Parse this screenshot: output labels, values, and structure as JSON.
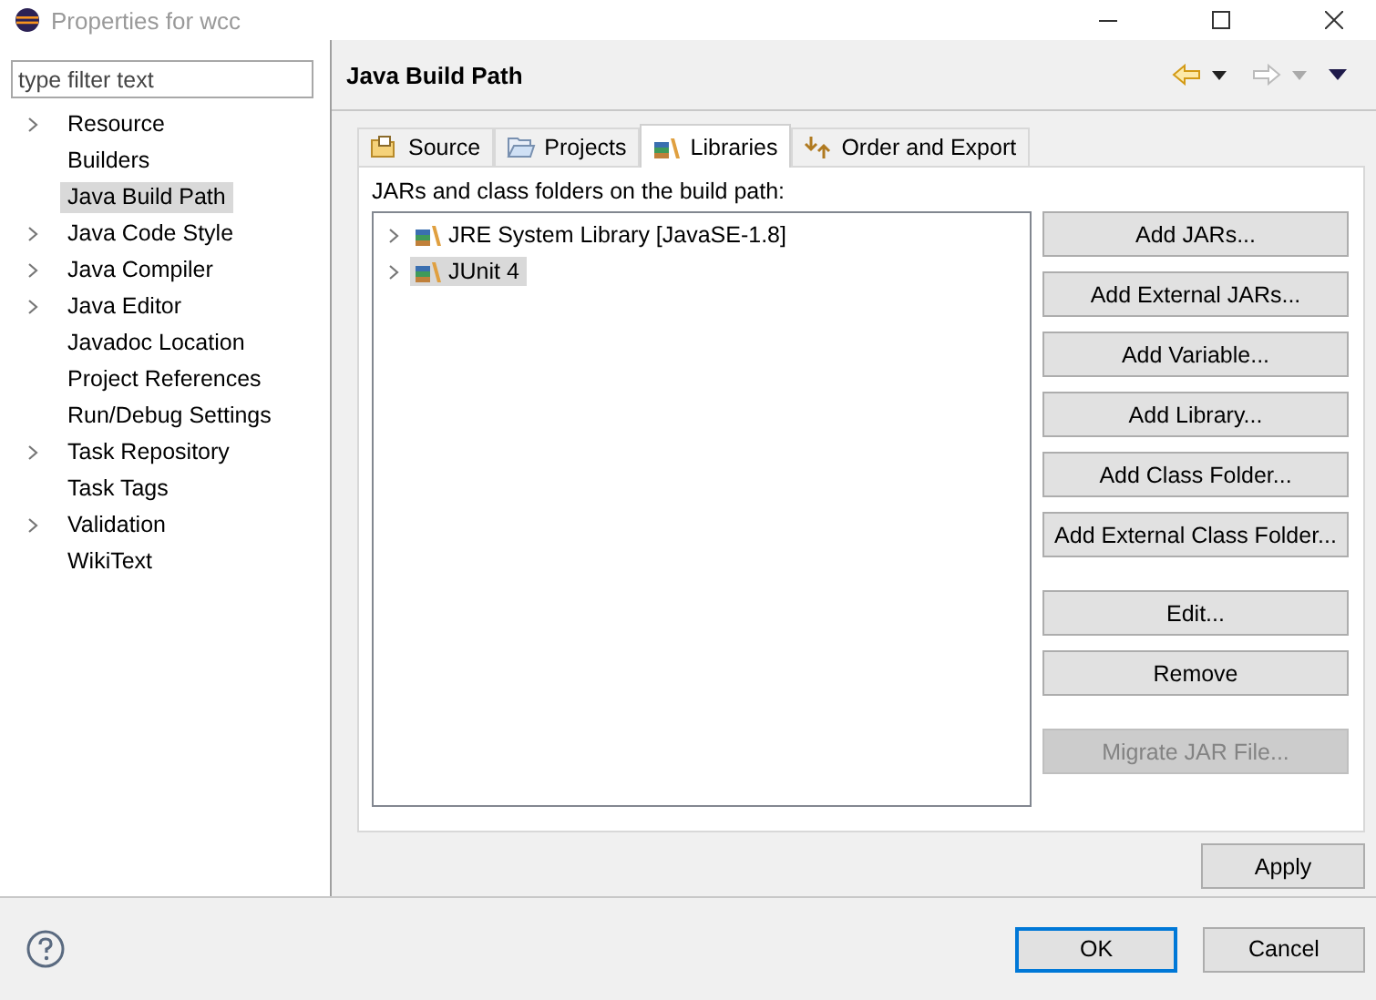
{
  "window": {
    "title": "Properties for wcc"
  },
  "sidebar": {
    "filter": {
      "placeholder": "type filter text"
    },
    "items": [
      {
        "label": "Resource",
        "expandable": true,
        "selected": false
      },
      {
        "label": "Builders",
        "expandable": false,
        "selected": false
      },
      {
        "label": "Java Build Path",
        "expandable": false,
        "selected": true
      },
      {
        "label": "Java Code Style",
        "expandable": true,
        "selected": false
      },
      {
        "label": "Java Compiler",
        "expandable": true,
        "selected": false
      },
      {
        "label": "Java Editor",
        "expandable": true,
        "selected": false
      },
      {
        "label": "Javadoc Location",
        "expandable": false,
        "selected": false
      },
      {
        "label": "Project References",
        "expandable": false,
        "selected": false
      },
      {
        "label": "Run/Debug Settings",
        "expandable": false,
        "selected": false
      },
      {
        "label": "Task Repository",
        "expandable": true,
        "selected": false
      },
      {
        "label": "Task Tags",
        "expandable": false,
        "selected": false
      },
      {
        "label": "Validation",
        "expandable": true,
        "selected": false
      },
      {
        "label": "WikiText",
        "expandable": false,
        "selected": false
      }
    ]
  },
  "page": {
    "title": "Java Build Path",
    "tabs": [
      {
        "label": "Source",
        "selected": false
      },
      {
        "label": "Projects",
        "selected": false
      },
      {
        "label": "Libraries",
        "selected": true
      },
      {
        "label": "Order and Export",
        "selected": false
      }
    ],
    "description": "JARs and class folders on the build path:",
    "tree": [
      {
        "label": "JRE System Library [JavaSE-1.8]",
        "expandable": true,
        "selected": false
      },
      {
        "label": "JUnit 4",
        "expandable": true,
        "selected": true
      }
    ],
    "button_groups": [
      [
        {
          "label": "Add JARs...",
          "disabled": false
        },
        {
          "label": "Add External JARs...",
          "disabled": false
        },
        {
          "label": "Add Variable...",
          "disabled": false
        },
        {
          "label": "Add Library...",
          "disabled": false
        },
        {
          "label": "Add Class Folder...",
          "disabled": false
        },
        {
          "label": "Add External Class Folder...",
          "disabled": false
        }
      ],
      [
        {
          "label": "Edit...",
          "disabled": false
        },
        {
          "label": "Remove",
          "disabled": false
        }
      ],
      [
        {
          "label": "Migrate JAR File...",
          "disabled": true
        }
      ]
    ],
    "apply": "Apply"
  },
  "footer": {
    "buttons": [
      {
        "label": "OK",
        "default": true
      },
      {
        "label": "Cancel",
        "default": false
      }
    ]
  }
}
